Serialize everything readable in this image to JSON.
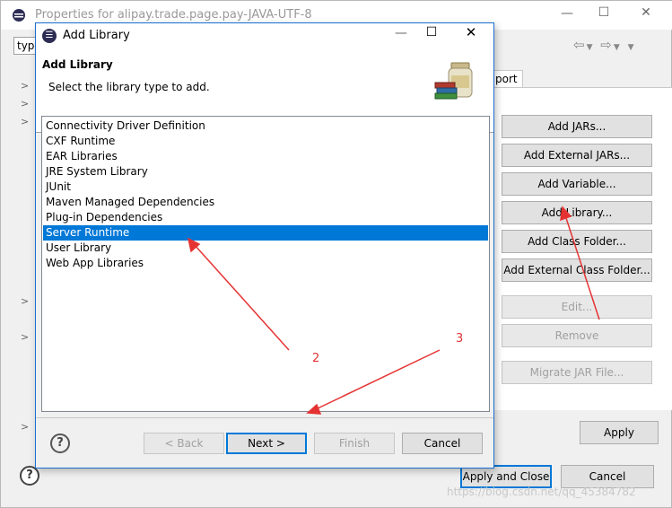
{
  "background_window": {
    "title": "Properties for alipay.trade.page.pay-JAVA-UTF-8",
    "filter_value": "type",
    "tab_label": "port",
    "buttons": {
      "add_jars": "Add JARs...",
      "add_external_jars": "Add External JARs...",
      "add_variable": "Add Variable...",
      "add_library": "Add Library...",
      "add_class_folder": "Add Class Folder...",
      "add_external_class_folder": "Add External Class Folder...",
      "edit": "Edit...",
      "remove": "Remove",
      "migrate_jar": "Migrate JAR File...",
      "apply": "Apply",
      "apply_and_close": "Apply and Close",
      "cancel": "Cancel"
    },
    "help_icon": "help-icon",
    "watermark": "https://blog.csdn.net/qq_45384782"
  },
  "dialog": {
    "window_title": "Add Library",
    "heading": "Add Library",
    "description": "Select the library type to add.",
    "library_types": [
      "Connectivity Driver Definition",
      "CXF Runtime",
      "EAR Libraries",
      "JRE System Library",
      "JUnit",
      "Maven Managed Dependencies",
      "Plug-in Dependencies",
      "Server Runtime",
      "User Library",
      "Web App Libraries"
    ],
    "selected_index": 7,
    "buttons": {
      "back": "< Back",
      "next": "Next >",
      "finish": "Finish",
      "cancel": "Cancel"
    }
  },
  "annotations": {
    "labels": [
      "2",
      "3"
    ],
    "color": "#e53333"
  },
  "colors": {
    "selection": "#0078d7",
    "dialog_border": "#1a6fd0"
  }
}
